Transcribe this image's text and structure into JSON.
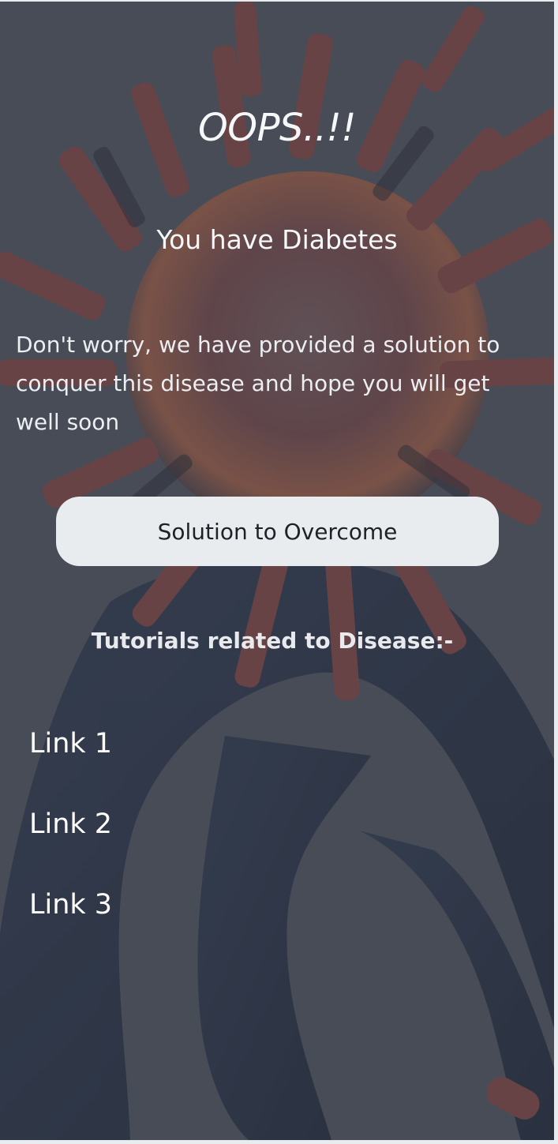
{
  "result": {
    "title": "OOPS..!!",
    "diagnosis": "You have Diabetes",
    "message": "Don't worry, we have provided a solution to conquer this disease and hope you will get well soon"
  },
  "actions": {
    "solution_button_label": "Solution to Overcome"
  },
  "tutorials": {
    "heading": "Tutorials related to Disease:-",
    "links": [
      {
        "label": "Link 1"
      },
      {
        "label": "Link 2"
      },
      {
        "label": "Link 3"
      }
    ]
  },
  "colors": {
    "overlay": "#474c57",
    "button_background": "#e9ecef",
    "button_text": "#1e2126",
    "text": "#f6f7f9"
  },
  "background_image": "virus-illustration"
}
